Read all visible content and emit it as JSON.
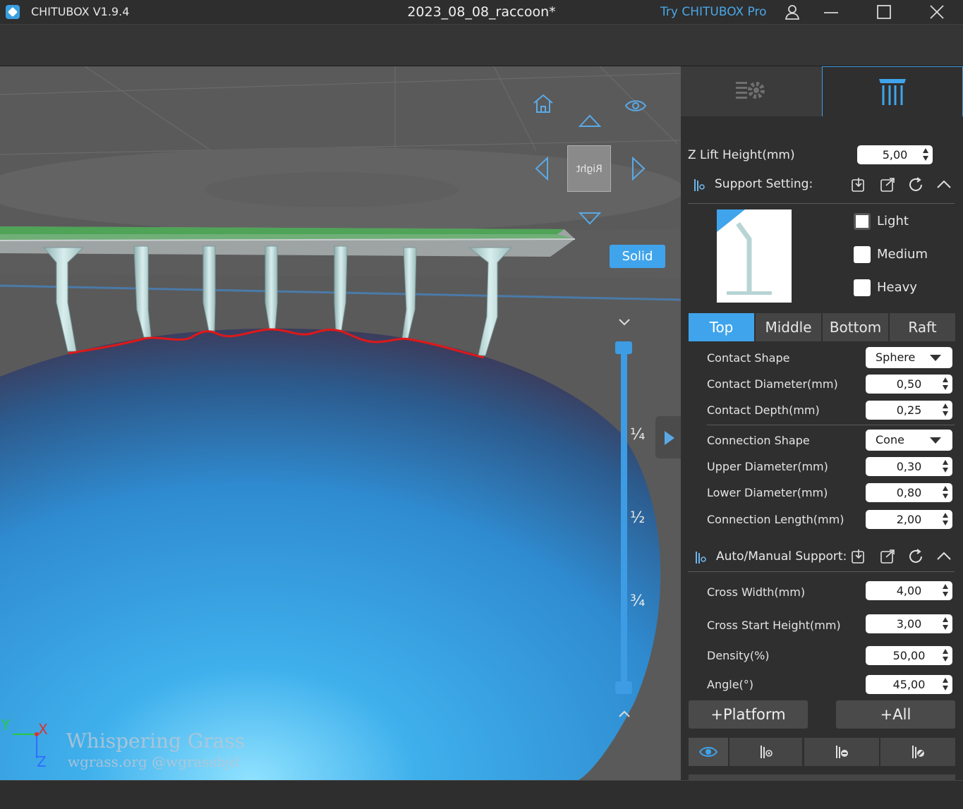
{
  "titlebar": {
    "app_name": "CHITUBOX V1.9.4",
    "document_title": "2023_08_08_raccoon*",
    "try_pro": "Try CHITUBOX Pro",
    "icons": [
      "user-icon",
      "minimize-icon",
      "maximize-icon",
      "close-icon"
    ]
  },
  "viewport": {
    "view_cube_label": "Right",
    "render_mode": "Solid",
    "slider_ticks": [
      "¼",
      "½",
      "¾"
    ],
    "axes": {
      "y": "Y",
      "x": "X",
      "z": "Z"
    },
    "watermark": {
      "line1": "Whispering Grass",
      "line2": "wgrass.org @wgrassbjd"
    },
    "colors": {
      "model": "#3d9ce4",
      "accent": "#3fa4ec",
      "support": "#b9d6d6",
      "contact_line": "#e01818"
    }
  },
  "panel": {
    "tabs": [
      {
        "icon": "settings-icon"
      },
      {
        "icon": "support-columns-icon"
      }
    ],
    "z_lift": {
      "label": "Z Lift Height(mm)",
      "value": "5,00"
    },
    "support_setting": {
      "title": "Support Setting:"
    },
    "presets": [
      {
        "label": "Light",
        "checked": true
      },
      {
        "label": "Medium",
        "checked": false
      },
      {
        "label": "Heavy",
        "checked": false
      }
    ],
    "tabs_segment": [
      "Top",
      "Middle",
      "Bottom",
      "Raft"
    ],
    "active_segment": "Top",
    "params": {
      "contact_shape": {
        "label": "Contact Shape",
        "value": "Sphere"
      },
      "contact_diameter": {
        "label": "Contact Diameter(mm)",
        "value": "0,50"
      },
      "contact_depth": {
        "label": "Contact Depth(mm)",
        "value": "0,25"
      },
      "connection_shape": {
        "label": "Connection Shape",
        "value": "Cone"
      },
      "upper_diameter": {
        "label": "Upper Diameter(mm)",
        "value": "0,30"
      },
      "lower_diameter": {
        "label": "Lower Diameter(mm)",
        "value": "0,80"
      },
      "connection_length": {
        "label": "Connection Length(mm)",
        "value": "2,00"
      }
    },
    "auto_manual": {
      "title": "Auto/Manual Support:"
    },
    "auto_params": {
      "cross_width": {
        "label": "Cross Width(mm)",
        "value": "4,00"
      },
      "cross_start_height": {
        "label": "Cross Start Height(mm)",
        "value": "3,00"
      },
      "density": {
        "label": "Density(%)",
        "value": "50,00"
      },
      "angle": {
        "label": "Angle(°)",
        "value": "45,00"
      }
    },
    "buttons": {
      "platform": "+Platform",
      "all": "+All"
    }
  }
}
